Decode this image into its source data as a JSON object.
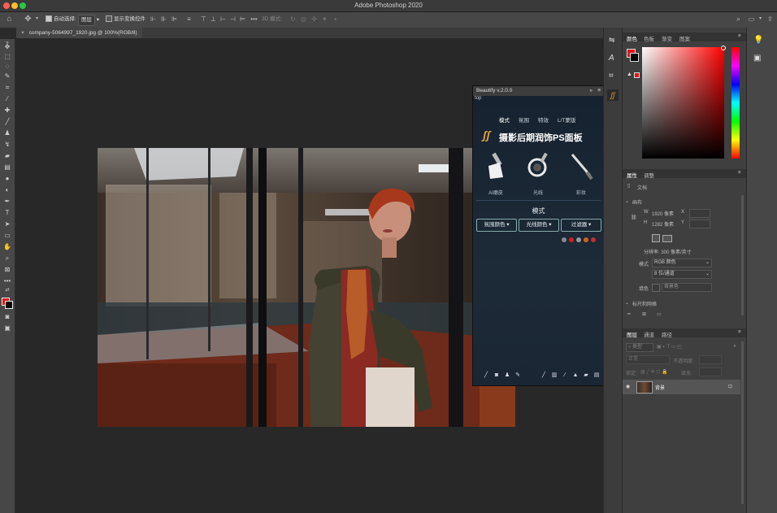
{
  "app_title": "Adobe Photoshop 2020",
  "options_bar": {
    "auto_select_label": "自动选择:",
    "auto_select_value": "图层",
    "show_transform_label": "显示变换控件",
    "mode_3d_label": "3D 模式:"
  },
  "document_tab": {
    "label": "company-5064997_1920.jpg @ 100%(RGB/8)"
  },
  "beautify": {
    "title": "Beautify v.2.0.0",
    "top_text": "top",
    "tabs": [
      "模式",
      "氛围",
      "特效",
      "L/T蒙版"
    ],
    "logo_text": "摄影后期润饰PS面板",
    "tools": [
      "AI磨皮",
      "光线",
      "彩妆"
    ],
    "mode_heading": "模式",
    "mode_buttons": [
      "氛围颜色 ▾",
      "光线颜色 ▾",
      "过滤器 ▾"
    ]
  },
  "color_panel": {
    "tabs": [
      "颜色",
      "色板",
      "渐变",
      "图案"
    ],
    "foreground_color": "#e0141a",
    "background_color": "#000000"
  },
  "properties_panel": {
    "tabs": [
      "属性",
      "调整"
    ],
    "doc_label": "文档",
    "canvas_heading": "画布",
    "width_label": "W",
    "width_value": "1920 像素",
    "x_label": "X",
    "height_label": "H",
    "height_value": "1282 像素",
    "y_label": "Y",
    "resolution_text": "分辨率: 300 像素/英寸",
    "mode_label": "模式",
    "mode_value": "RGB 颜色",
    "bit_depth_value": "8 位/通道",
    "fill_label": "填色",
    "fill_value": "背景色",
    "rulers_heading": "标尺和网格"
  },
  "layers_panel": {
    "tabs": [
      "图层",
      "通道",
      "路径"
    ],
    "kind_label": "类型",
    "blend_mode": "正常",
    "opacity_label": "不透明度:",
    "lock_label": "锁定:",
    "fill_label": "填充:",
    "layer_name": "背景"
  }
}
